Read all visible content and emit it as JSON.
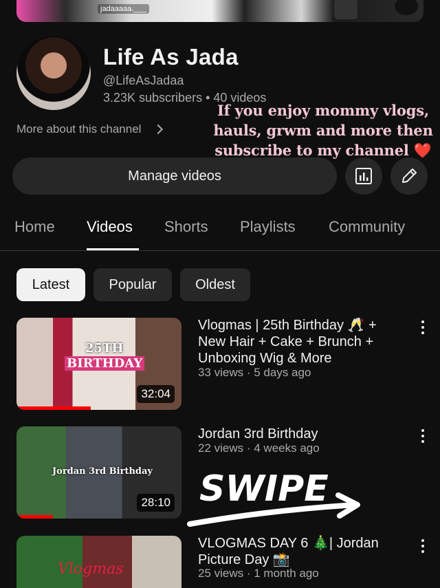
{
  "banner": {
    "handle": "jadaaaaa.___"
  },
  "channel": {
    "name": "Life As Jada",
    "handle": "@LifeAsJadaa",
    "stats": "3.23K subscribers • 40 videos",
    "more_about": "More about this channel"
  },
  "promo": {
    "line1": "If you enjoy mommy vlogs,",
    "line2": "hauls, grwm and more then",
    "line3": "subscribe to my channel",
    "heart": "❤️"
  },
  "actions": {
    "manage_videos": "Manage videos",
    "analytics_icon": "analytics-icon",
    "edit_icon": "pencil-icon"
  },
  "tabs": [
    {
      "label": "Home",
      "active": false
    },
    {
      "label": "Videos",
      "active": true
    },
    {
      "label": "Shorts",
      "active": false
    },
    {
      "label": "Playlists",
      "active": false
    },
    {
      "label": "Community",
      "active": false
    }
  ],
  "chips": [
    {
      "label": "Latest",
      "active": true
    },
    {
      "label": "Popular",
      "active": false
    },
    {
      "label": "Oldest",
      "active": false
    }
  ],
  "videos": [
    {
      "title": "Vlogmas | 25th Birthday 🥂 + New Hair + Cake + Brunch + Unboxing Wig & More",
      "meta": "33 views · 5 days ago",
      "duration": "32:04",
      "thumb_text_1": "25TH",
      "thumb_text_2": "BIRTHDAY",
      "watched_fraction": 0.45
    },
    {
      "title": "Jordan 3rd Birthday",
      "meta": "22 views · 4 weeks ago",
      "duration": "28:10",
      "thumb_text": "Jordan 3rd Birthday",
      "watched_fraction": 0.22
    },
    {
      "title": "VLOGMAS DAY 6 🎄| Jordan Picture Day 📸",
      "meta": "25 views · 1 month ago",
      "thumb_text": "Vlogmas"
    }
  ],
  "overlay": {
    "swipe": "SWIPE"
  },
  "colors": {
    "background": "#0f0f0f",
    "surface": "#272727",
    "accent_red": "#ff0000",
    "promo_pink": "#f3c6d6"
  }
}
